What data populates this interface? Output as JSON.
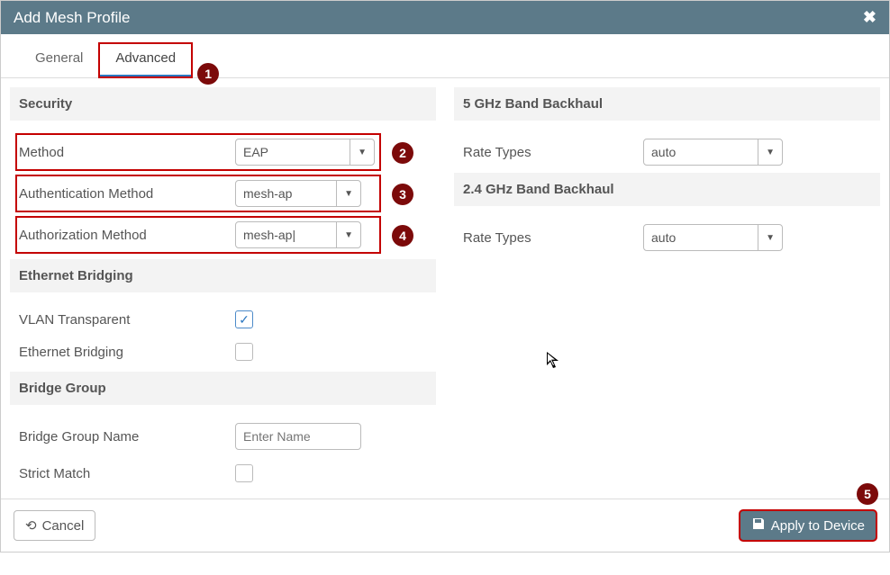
{
  "window": {
    "title": "Add Mesh Profile"
  },
  "tabs": {
    "general": "General",
    "advanced": "Advanced"
  },
  "annotations": {
    "b1": "1",
    "b2": "2",
    "b3": "3",
    "b4": "4",
    "b5": "5"
  },
  "left": {
    "security_head": "Security",
    "method_label": "Method",
    "method_value": "EAP",
    "authn_label": "Authentication Method",
    "authn_value": "mesh-ap",
    "authz_label": "Authorization Method",
    "authz_value": "mesh-ap|",
    "eth_head": "Ethernet Bridging",
    "vlan_label": "VLAN Transparent",
    "ethbr_label": "Ethernet Bridging",
    "bridge_head": "Bridge Group",
    "bgname_label": "Bridge Group Name",
    "bgname_placeholder": "Enter Name",
    "strict_label": "Strict Match"
  },
  "right": {
    "band5_head": "5 GHz Band Backhaul",
    "rate5_label": "Rate Types",
    "rate5_value": "auto",
    "band24_head": "2.4 GHz Band Backhaul",
    "rate24_label": "Rate Types",
    "rate24_value": "auto"
  },
  "buttons": {
    "cancel": "Cancel",
    "apply": "Apply to Device"
  }
}
